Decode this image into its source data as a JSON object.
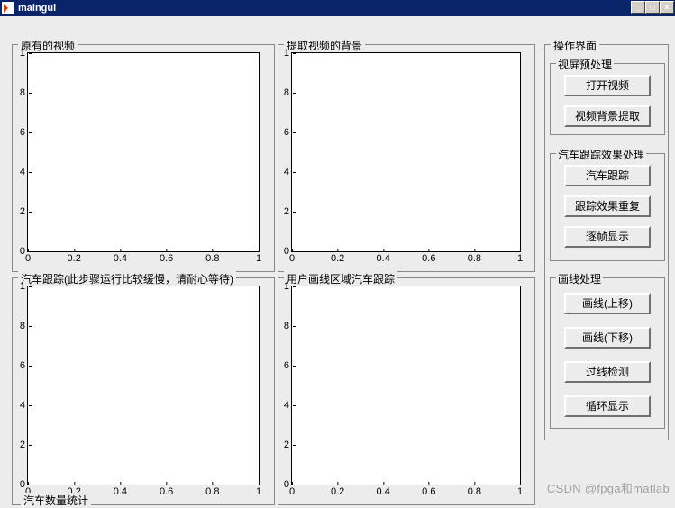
{
  "window": {
    "title": "maingui"
  },
  "panels": {
    "top_left": {
      "title": "原有的视频"
    },
    "top_right": {
      "title": "提取视频的背景"
    },
    "bottom_left": {
      "title": "汽车跟踪(此步骤运行比较缓慢，请耐心等待)"
    },
    "bottom_right": {
      "title": "用户画线区域汽车跟踪"
    },
    "stats": {
      "title": "汽车数量统计"
    }
  },
  "ops": {
    "title": "操作界面",
    "group1": {
      "title": "视屏预处理",
      "btn1": "打开视频",
      "btn2": "视频背景提取"
    },
    "group2": {
      "title": "汽车跟踪效果处理",
      "btn1": "汽车跟踪",
      "btn2": "跟踪效果重复",
      "btn3": "逐帧显示"
    },
    "group3": {
      "title": "画线处理",
      "btn1": "画线(上移)",
      "btn2": "画线(下移)",
      "btn3": "过线检测",
      "btn4": "循环显示"
    }
  },
  "chart_data": [
    {
      "type": "line",
      "title": "原有的视频",
      "x": [],
      "y": [],
      "xlim": [
        0,
        1
      ],
      "ylim": [
        0,
        1
      ],
      "xticks": [
        0,
        0.2,
        0.4,
        0.6,
        0.8,
        1
      ],
      "yticks": [
        0,
        2,
        4,
        6,
        8,
        1
      ]
    },
    {
      "type": "line",
      "title": "提取视频的背景",
      "x": [],
      "y": [],
      "xlim": [
        0,
        1
      ],
      "ylim": [
        0,
        1
      ],
      "xticks": [
        0,
        0.2,
        0.4,
        0.6,
        0.8,
        1
      ],
      "yticks": [
        0,
        2,
        4,
        6,
        8,
        1
      ]
    },
    {
      "type": "line",
      "title": "汽车跟踪",
      "x": [],
      "y": [],
      "xlim": [
        0,
        1
      ],
      "ylim": [
        0,
        1
      ],
      "xticks": [
        0,
        0.2,
        0.4,
        0.6,
        0.8,
        1
      ],
      "yticks": [
        0,
        2,
        4,
        6,
        8,
        1
      ]
    },
    {
      "type": "line",
      "title": "用户画线区域汽车跟踪",
      "x": [],
      "y": [],
      "xlim": [
        0,
        1
      ],
      "ylim": [
        0,
        1
      ],
      "xticks": [
        0,
        0.2,
        0.4,
        0.6,
        0.8,
        1
      ],
      "yticks": [
        0,
        2,
        4,
        6,
        8,
        1
      ]
    }
  ],
  "ticks": {
    "y": [
      "1",
      "8",
      "6",
      "4",
      "2",
      "0"
    ],
    "x": [
      "0",
      "0.2",
      "0.4",
      "0.6",
      "0.8",
      "1"
    ]
  },
  "watermark": "CSDN @fpga和matlab"
}
